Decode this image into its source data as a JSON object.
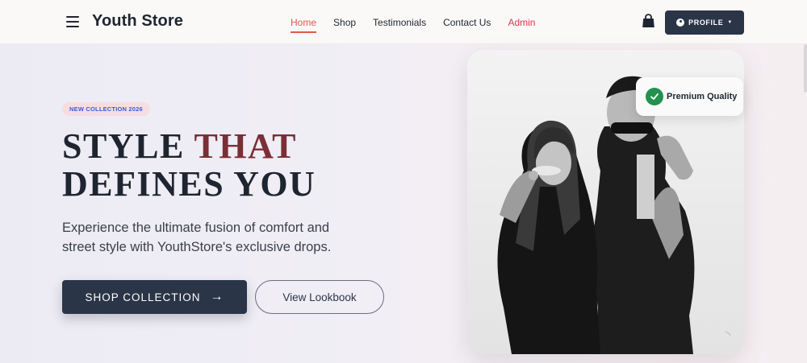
{
  "navbar": {
    "brand": "Youth Store",
    "links": [
      {
        "label": "Home",
        "active": true
      },
      {
        "label": "Shop"
      },
      {
        "label": "Testimonials"
      },
      {
        "label": "Contact Us"
      },
      {
        "label": "Admin"
      }
    ],
    "profile_label": "PROFILE",
    "icons": {
      "menu": "hamburger-icon",
      "cart": "shopping-bag-icon",
      "user": "user-circle-icon",
      "caret": "caret-down-icon"
    }
  },
  "hero": {
    "badge": "NEW COLLECTION 2026",
    "headline_part1": "STYLE ",
    "headline_accent": "THAT",
    "headline_line2": "DEFINES YOU",
    "subtitle": "Experience the ultimate fusion of comfort and street style with YouthStore's exclusive drops.",
    "primary_cta": "SHOP COLLECTION",
    "secondary_cta": "View Lookbook",
    "quality_badge": "Premium Quality"
  },
  "colors": {
    "brand_dark": "#2b3548",
    "accent_red": "#e1574f",
    "headline_accent": "#7a2e35",
    "badge_bg": "#f7dde0",
    "badge_text": "#3a5bd8",
    "check_green": "#24914f"
  }
}
